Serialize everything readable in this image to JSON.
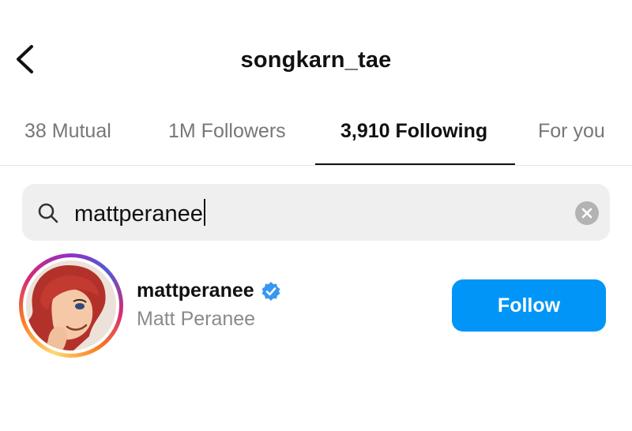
{
  "header": {
    "title": "songkarn_tae",
    "back_icon": "chevron-left-icon"
  },
  "tabs": [
    {
      "label": "38 Mutual",
      "active": false
    },
    {
      "label": "1M Followers",
      "active": false
    },
    {
      "label": "3,910 Following",
      "active": true
    },
    {
      "label": "For you",
      "active": false
    }
  ],
  "search": {
    "value": "mattperanee",
    "icon": "search-icon",
    "clear_icon": "clear-icon"
  },
  "results": [
    {
      "username": "mattperanee",
      "full_name": "Matt Peranee",
      "verified": true,
      "has_story": true,
      "button_label": "Follow"
    }
  ],
  "colors": {
    "accent": "#0095f6",
    "verified": "#3897f0",
    "muted_text": "#8a8a8a"
  }
}
